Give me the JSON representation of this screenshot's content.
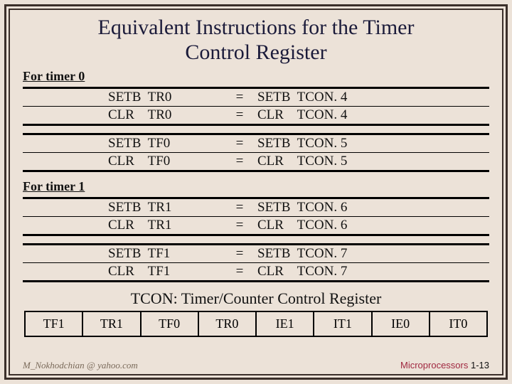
{
  "title_line1": "Equivalent Instructions for the Timer",
  "title_line2": "Control Register",
  "sections": [
    {
      "label": "For timer 0",
      "blocks": [
        {
          "rows": [
            {
              "left": "SETB  TR0",
              "eq": "=",
              "right": "SETB  TCON. 4"
            },
            {
              "left": "CLR    TR0",
              "eq": "=",
              "right": "CLR    TCON. 4"
            }
          ]
        },
        {
          "rows": [
            {
              "left": "SETB  TF0",
              "eq": "=",
              "right": "SETB  TCON. 5"
            },
            {
              "left": "CLR    TF0",
              "eq": "=",
              "right": "CLR    TCON. 5"
            }
          ]
        }
      ]
    },
    {
      "label": "For timer 1",
      "blocks": [
        {
          "rows": [
            {
              "left": "SETB  TR1",
              "eq": "=",
              "right": "SETB  TCON. 6"
            },
            {
              "left": "CLR    TR1",
              "eq": "=",
              "right": "CLR    TCON. 6"
            }
          ]
        },
        {
          "rows": [
            {
              "left": "SETB  TF1",
              "eq": "=",
              "right": "SETB  TCON. 7"
            },
            {
              "left": "CLR    TF1",
              "eq": "=",
              "right": "CLR    TCON. 7"
            }
          ]
        }
      ]
    }
  ],
  "caption": "TCON: Timer/Counter Control Register",
  "register_bits": [
    "TF1",
    "TR1",
    "TF0",
    "TR0",
    "IE1",
    "IT1",
    "IE0",
    "IT0"
  ],
  "footer": {
    "left": "M_Nokhodchian @ yahoo.com",
    "right_text": "Microprocessors ",
    "right_page": "1-13"
  }
}
